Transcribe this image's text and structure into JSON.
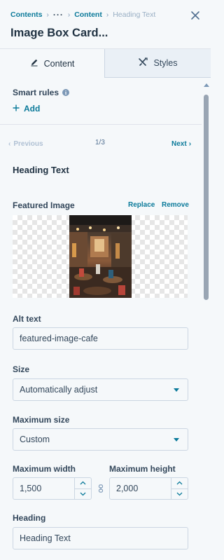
{
  "breadcrumb": {
    "root": "Contents",
    "ellipsis": "···",
    "parent": "Content",
    "current": "Heading Text"
  },
  "panel": {
    "title": "Image Box Card..."
  },
  "tabs": [
    {
      "label": "Content",
      "icon": "pencil-icon",
      "active": true
    },
    {
      "label": "Styles",
      "icon": "styles-icon",
      "active": false
    }
  ],
  "smart_rules": {
    "label": "Smart rules",
    "add_label": "Add"
  },
  "pager": {
    "previous": "Previous",
    "count": "1/3",
    "next": "Next"
  },
  "item": {
    "title": "Heading Text"
  },
  "featured_image": {
    "label": "Featured Image",
    "replace": "Replace",
    "remove": "Remove"
  },
  "alt_text": {
    "label": "Alt text",
    "value": "featured-image-cafe"
  },
  "size": {
    "label": "Size",
    "value": "Automatically adjust"
  },
  "max_size": {
    "label": "Maximum size",
    "value": "Custom"
  },
  "max_width": {
    "label": "Maximum width",
    "value": "1,500"
  },
  "max_height": {
    "label": "Maximum height",
    "value": "2,000"
  },
  "heading": {
    "label": "Heading",
    "value": "Heading Text"
  },
  "colors": {
    "accent": "#0b7a9a",
    "text": "#33475b",
    "panel_bg": "#f5f8fa",
    "border": "#cbd6e2"
  }
}
